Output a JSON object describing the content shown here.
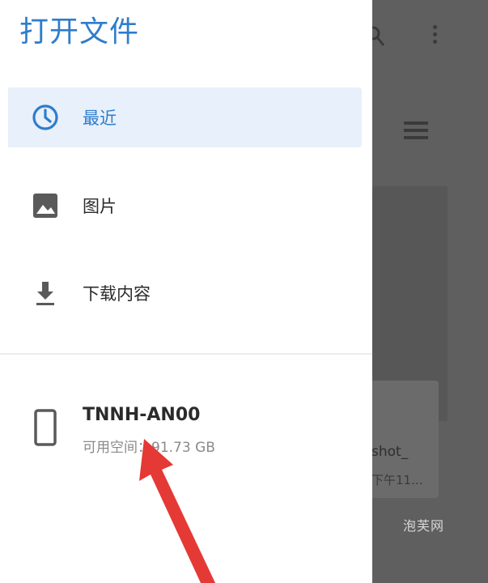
{
  "drawer": {
    "title": "打开文件",
    "items": [
      {
        "label": "最近",
        "icon": "clock-icon",
        "active": true
      },
      {
        "label": "图片",
        "icon": "image-icon",
        "active": false
      },
      {
        "label": "下载内容",
        "icon": "download-icon",
        "active": false
      }
    ],
    "device": {
      "name": "TNNH-AN00",
      "info": "可用空间：91.73 GB",
      "icon": "phone-icon"
    }
  },
  "background": {
    "file_name": "shot_",
    "file_date": "下午11..."
  },
  "watermark": "泡芙网",
  "colors": {
    "accent": "#2f7dcb",
    "active_bg": "#e8f0fb",
    "scrim": "#5f5f5f",
    "arrow": "#e53935"
  }
}
